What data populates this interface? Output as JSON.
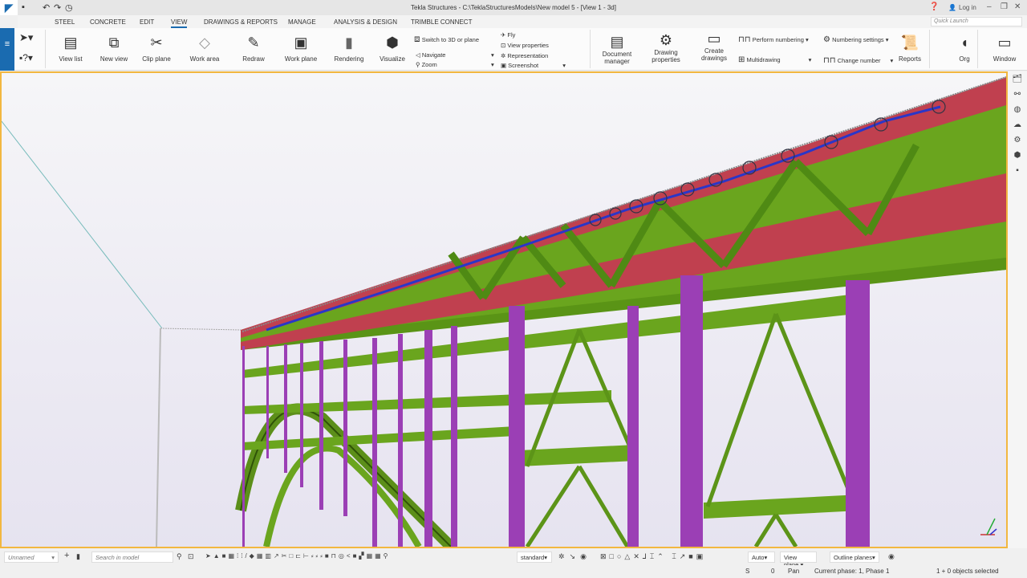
{
  "app": {
    "title": "Tekla Structures - C:\\TeklaStructuresModels\\New model 5  - [View 1 - 3d]",
    "login": "Log in"
  },
  "tabs": [
    "STEEL",
    "CONCRETE",
    "EDIT",
    "VIEW",
    "DRAWINGS & REPORTS",
    "MANAGE",
    "ANALYSIS & DESIGN",
    "TRIMBLE CONNECT"
  ],
  "quick_launch": {
    "placeholder": "Quick Launch"
  },
  "ribbon": {
    "view_list": "View list",
    "new_view": "New view",
    "clip_plane": "Clip plane",
    "work_area": "Work area",
    "redraw": "Redraw",
    "work_plane": "Work plane",
    "rendering": "Rendering",
    "visualize": "Visualize",
    "switch": "Switch to 3D or plane",
    "navigate": "Navigate",
    "zoom": "Zoom",
    "fly": "Fly",
    "view_properties": "View properties",
    "representation": "Representation",
    "screenshot": "Screenshot",
    "document_manager": [
      "Document",
      "manager"
    ],
    "drawing_properties": [
      "Drawing",
      "properties"
    ],
    "create_drawings": [
      "Create",
      "drawings"
    ],
    "perform_numbering": "Perform numbering",
    "multidrawing": "Multidrawing",
    "numbering_settings": "Numbering settings",
    "change_number": "Change number",
    "reports": "Reports",
    "org": "Org",
    "window": "Window"
  },
  "toolbar": {
    "selection_set": "Unnamed",
    "search_placeholder": "Search in model",
    "display": "standard",
    "auto": "Auto",
    "view_plane": "View plane",
    "outline_planes": "Outline planes"
  },
  "status": {
    "s": "S",
    "zero": "0",
    "mode": "Pan",
    "phase": "Current phase: 1, Phase 1",
    "selected": "1 + 0 objects selected"
  },
  "colors": {
    "accent": "#1a6bb0",
    "viewport_border": "#f2b740",
    "beam_red": "#c0404f",
    "steel_green": "#6aa51e",
    "column_purple": "#9b3fb5"
  }
}
